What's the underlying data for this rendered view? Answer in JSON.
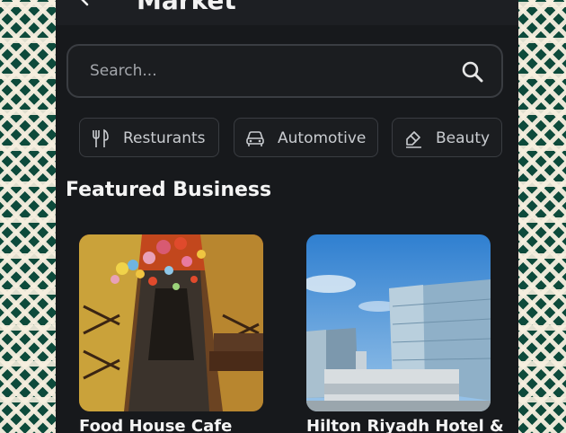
{
  "header": {
    "title": "Market"
  },
  "search": {
    "placeholder": "Search..."
  },
  "categories": [
    {
      "label": "Resturants",
      "icon": "utensils-icon"
    },
    {
      "label": "Automotive",
      "icon": "car-icon"
    },
    {
      "label": "Beauty",
      "icon": "brush-icon"
    }
  ],
  "featured": {
    "title": "Featured Business",
    "items": [
      {
        "name": "Food House Cafe",
        "image": "restaurant-interior-image"
      },
      {
        "name": "Hilton Riyadh Hotel &",
        "image": "hotel-building-image"
      }
    ]
  },
  "colors": {
    "panel_bg": "#17191c",
    "border": "#3a3d42",
    "text_primary": "#f4f4f4",
    "text_secondary": "#c9ccd0",
    "pattern_green": "#0d4a3b",
    "pattern_cream": "#f6efdf"
  }
}
